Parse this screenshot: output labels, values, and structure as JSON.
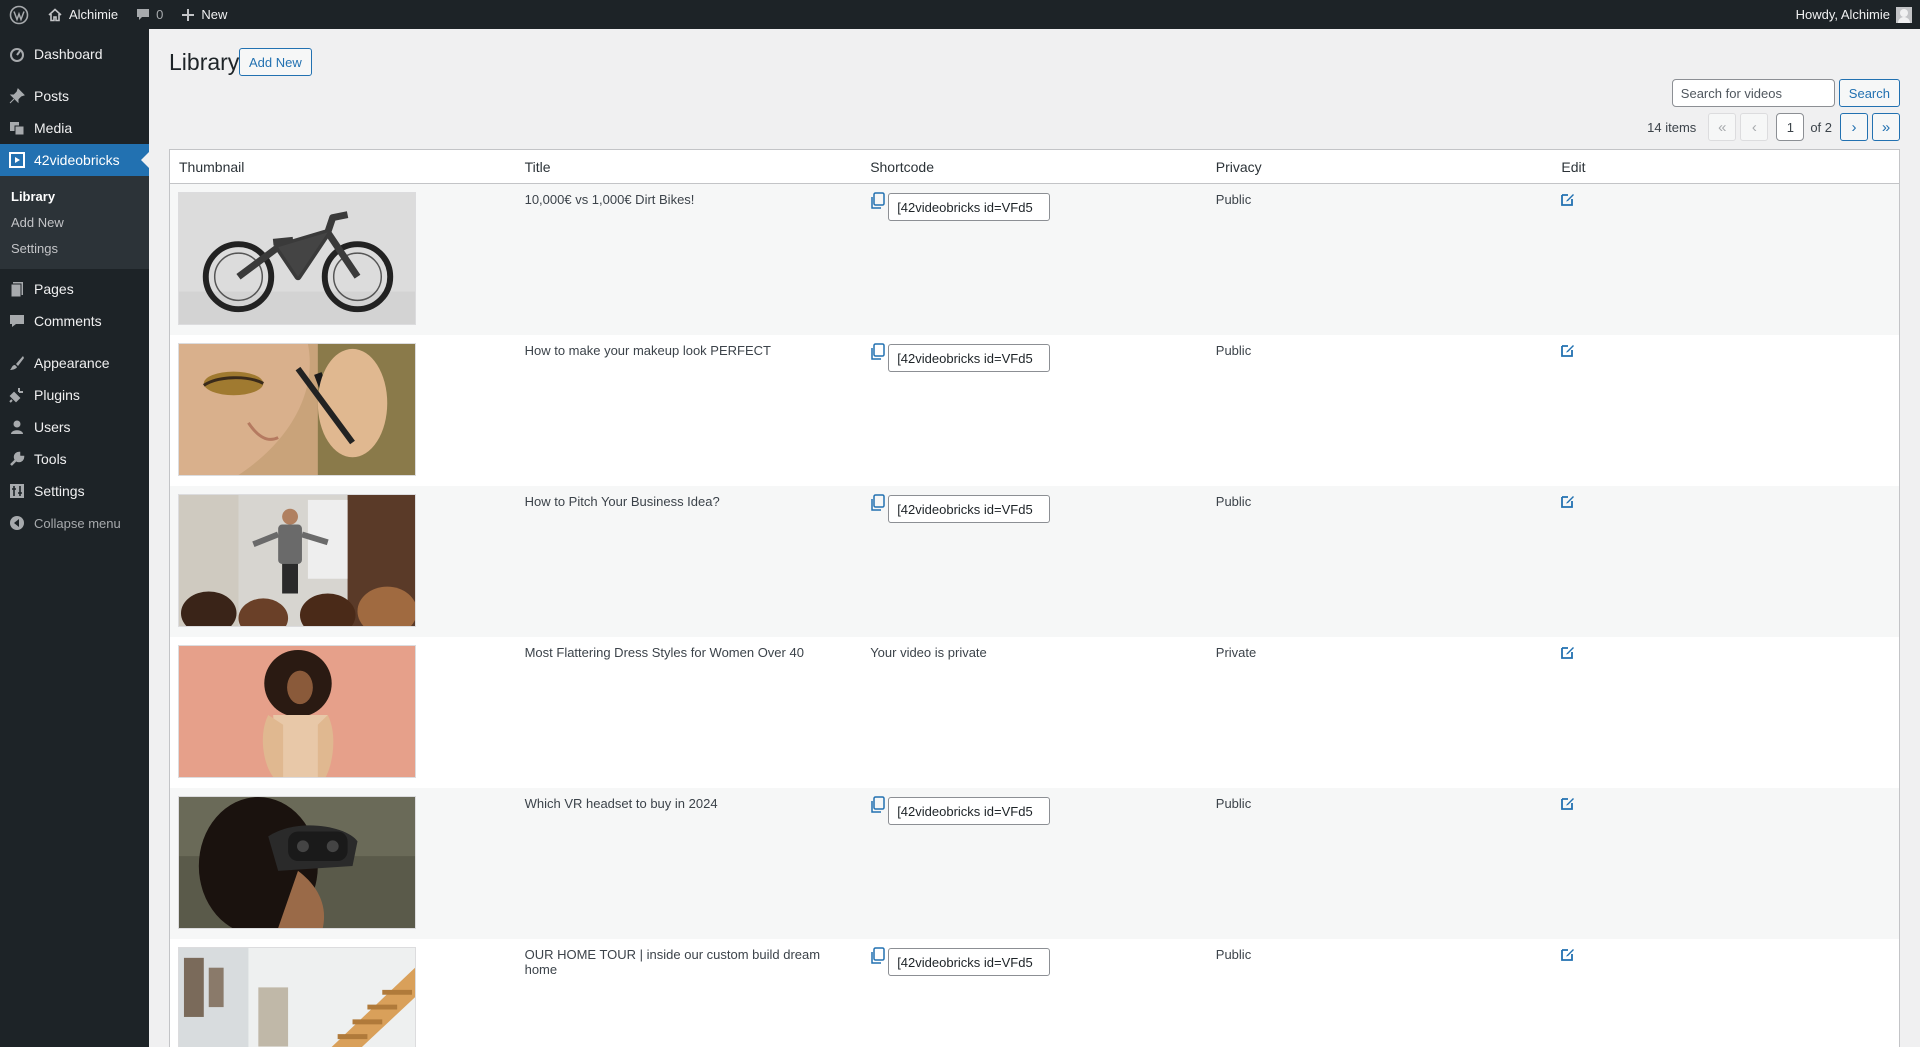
{
  "adminbar": {
    "site_name": "Alchimie",
    "comments_count": "0",
    "new_label": "New",
    "howdy": "Howdy, Alchimie"
  },
  "sidebar": {
    "items": [
      {
        "label": "Dashboard",
        "icon": "dashboard-icon"
      },
      {
        "label": "Posts",
        "icon": "pin-icon"
      },
      {
        "label": "Media",
        "icon": "media-icon"
      },
      {
        "label": "42videobricks",
        "icon": "video-icon",
        "current": true
      },
      {
        "label": "Pages",
        "icon": "pages-icon"
      },
      {
        "label": "Comments",
        "icon": "comment-icon"
      },
      {
        "label": "Appearance",
        "icon": "brush-icon"
      },
      {
        "label": "Plugins",
        "icon": "plugin-icon"
      },
      {
        "label": "Users",
        "icon": "user-icon"
      },
      {
        "label": "Tools",
        "icon": "wrench-icon"
      },
      {
        "label": "Settings",
        "icon": "settings-icon"
      }
    ],
    "submenu": [
      {
        "label": "Library",
        "current": true
      },
      {
        "label": "Add New"
      },
      {
        "label": "Settings"
      }
    ],
    "collapse_label": "Collapse menu"
  },
  "page": {
    "title": "Library",
    "add_new_label": "Add New"
  },
  "search": {
    "placeholder": "Search for videos",
    "button_label": "Search"
  },
  "pagination": {
    "items_label": "14 items",
    "first": "«",
    "prev": "‹",
    "current_page": "1",
    "of_total": "of 2",
    "next": "›",
    "last": "»"
  },
  "table": {
    "columns": [
      "Thumbnail",
      "Title",
      "Shortcode",
      "Privacy",
      "Edit"
    ],
    "rows": [
      {
        "title": "10,000€ vs 1,000€ Dirt Bikes!",
        "shortcode": "[42videobricks id=VFd5",
        "privacy": "Public",
        "thumb": "dirt-bike"
      },
      {
        "title": "How to make your makeup look PERFECT",
        "shortcode": "[42videobricks id=VFd5",
        "privacy": "Public",
        "thumb": "makeup"
      },
      {
        "title": "How to Pitch Your Business Idea?",
        "shortcode": "[42videobricks id=VFd5",
        "privacy": "Public",
        "thumb": "presentation"
      },
      {
        "title": "Most Flattering Dress Styles for Women Over 40",
        "shortcode_text": "Your video is private",
        "privacy": "Private",
        "thumb": "fashion"
      },
      {
        "title": "Which VR headset to buy in 2024",
        "shortcode": "[42videobricks id=VFd5",
        "privacy": "Public",
        "thumb": "vr-headset"
      },
      {
        "title": "OUR HOME TOUR | inside our custom build dream home",
        "shortcode": "[42videobricks id=VFd5",
        "privacy": "Public",
        "thumb": "home-interior"
      }
    ]
  },
  "colors": {
    "admin_bar": "#1d2327",
    "accent": "#2271b1",
    "background": "#f0f0f1"
  }
}
